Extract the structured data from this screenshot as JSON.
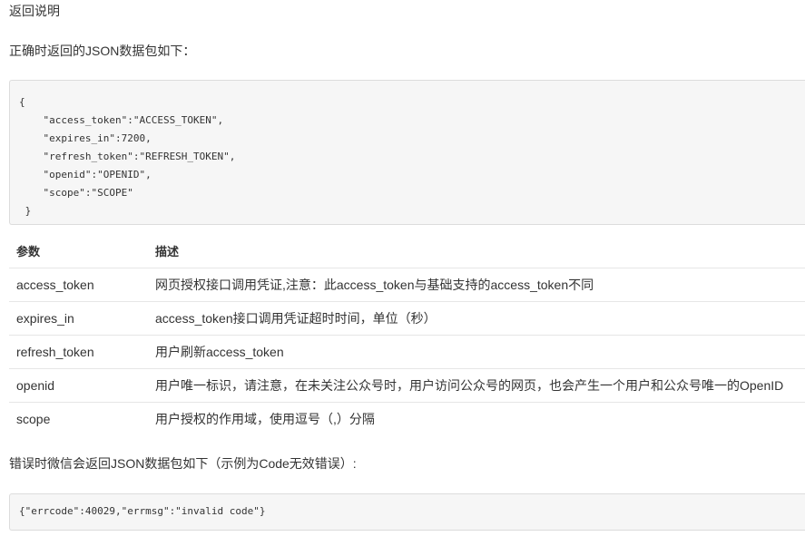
{
  "heading": "返回说明",
  "intro": "正确时返回的JSON数据包如下：",
  "code_lines": [
    "{",
    "    \"access_token\":\"ACCESS_TOKEN\",",
    "    \"expires_in\":7200,",
    "    \"refresh_token\":\"REFRESH_TOKEN\",",
    "    \"openid\":\"OPENID\",",
    "    \"scope\":\"SCOPE\"",
    " }"
  ],
  "table": {
    "headers": [
      "参数",
      "描述"
    ],
    "rows": [
      {
        "param": "access_token",
        "desc": "网页授权接口调用凭证,注意：此access_token与基础支持的access_token不同"
      },
      {
        "param": "expires_in",
        "desc": "access_token接口调用凭证超时时间，单位（秒）"
      },
      {
        "param": "refresh_token",
        "desc": "用户刷新access_token"
      },
      {
        "param": "openid",
        "desc": "用户唯一标识，请注意，在未关注公众号时，用户访问公众号的网页，也会产生一个用户和公众号唯一的OpenID"
      },
      {
        "param": "scope",
        "desc": "用户授权的作用域，使用逗号（,）分隔"
      }
    ]
  },
  "error_intro": "错误时微信会返回JSON数据包如下（示例为Code无效错误）:",
  "error_code": "{\"errcode\":40029,\"errmsg\":\"invalid code\"}"
}
